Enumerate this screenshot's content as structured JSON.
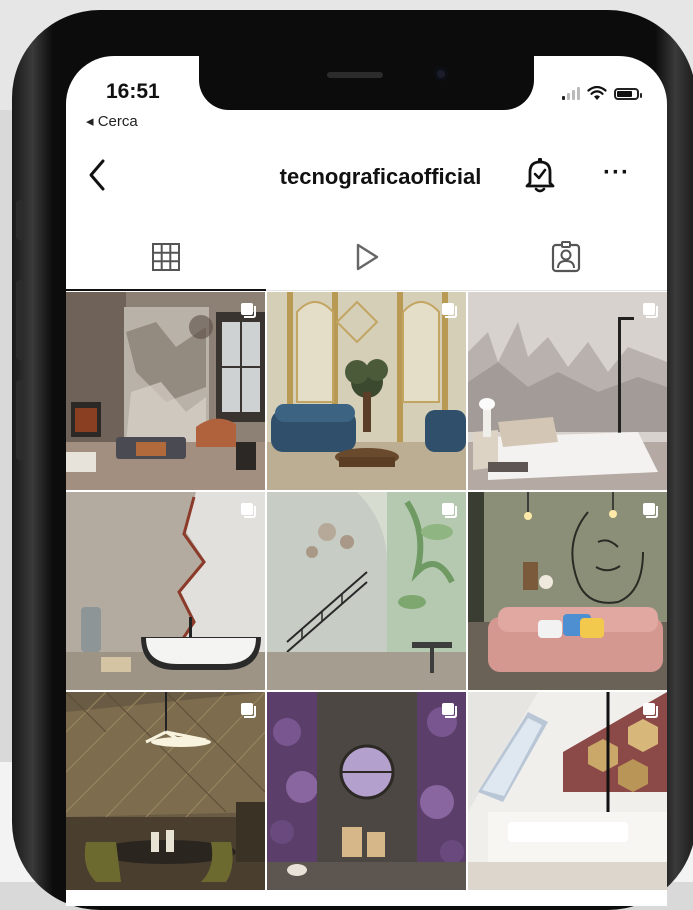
{
  "status_bar": {
    "time": "16:51",
    "back_app_label": "◂ Cerca"
  },
  "profile": {
    "username": "tecnograficaofficial"
  },
  "header_icons": [
    "back-chevron-icon",
    "bell-icon",
    "more-icon"
  ],
  "tabs": [
    {
      "name": "grid",
      "icon": "grid-icon",
      "active": true
    },
    {
      "name": "reels",
      "icon": "play-icon",
      "active": false
    },
    {
      "name": "tagged",
      "icon": "tagged-person-icon",
      "active": false
    }
  ],
  "posts": [
    {
      "scene": "loft living room with marble feature wall",
      "multi": true
    },
    {
      "scene": "art deco gold wallpaper with blue velvet sofas",
      "multi": true
    },
    {
      "scene": "misty forest wallpaper bedroom",
      "multi": true
    },
    {
      "scene": "cracked stone bathroom with freestanding tub",
      "multi": true
    },
    {
      "scene": "stairway with green botanical mural",
      "multi": true
    },
    {
      "scene": "line-art mural lounge with pink sofa",
      "multi": true
    },
    {
      "scene": "dining room with gold wall panels",
      "multi": true
    },
    {
      "scene": "amethyst stone wall with round window",
      "multi": true
    },
    {
      "scene": "attic with hexagon wall decor",
      "multi": true
    }
  ],
  "colors": {
    "text": "#111111",
    "accent": "#000000",
    "divider": "#e3e3e3"
  }
}
